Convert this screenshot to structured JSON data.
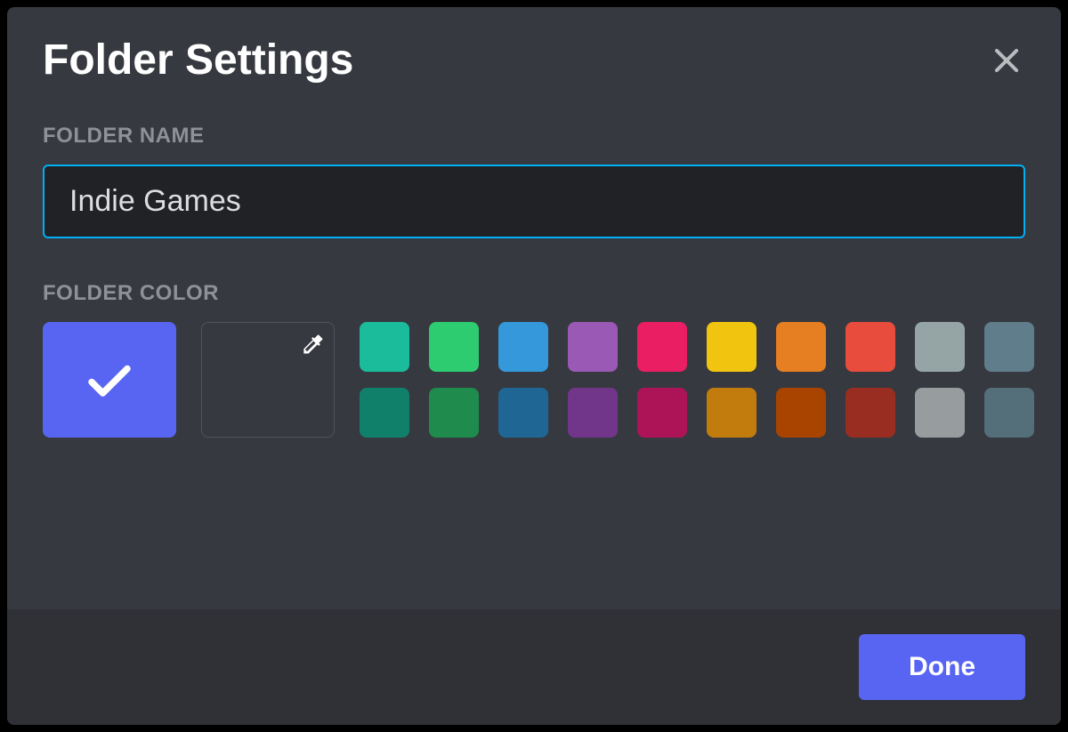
{
  "modal": {
    "title": "Folder Settings",
    "done_label": "Done"
  },
  "folder_name": {
    "label": "FOLDER NAME",
    "value": "Indie Games"
  },
  "folder_color": {
    "label": "FOLDER COLOR",
    "selected_color": "#5865f2",
    "default_swatch_color": "#5865f2",
    "palette": [
      "#1abc9c",
      "#2ecc71",
      "#3498db",
      "#9b59b6",
      "#e91e63",
      "#f1c40f",
      "#e67e22",
      "#e74c3c",
      "#95a5a6",
      "#607d8b",
      "#11806a",
      "#1f8b4c",
      "#206694",
      "#71368a",
      "#ad1457",
      "#c27c0e",
      "#a84300",
      "#992d22",
      "#979c9f",
      "#546e7a"
    ]
  }
}
